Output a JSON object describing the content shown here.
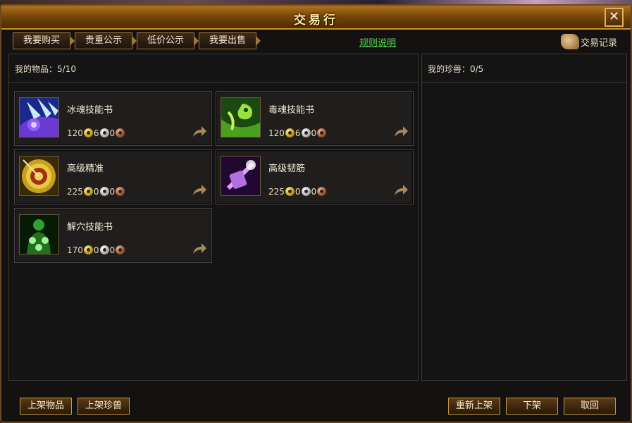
{
  "window": {
    "title": "交易行",
    "close_label": "✕"
  },
  "tabs": [
    {
      "label": "我要购买"
    },
    {
      "label": "贵重公示"
    },
    {
      "label": "低价公示"
    },
    {
      "label": "我要出售"
    }
  ],
  "rules_link": "规则说明",
  "records_label": "交易记录",
  "left_panel": {
    "header": "我的物品：5/10"
  },
  "right_panel": {
    "header": "我的珍兽：0/5"
  },
  "items": [
    {
      "name": "冰魂技能书",
      "gold": "120",
      "silver": "6",
      "copper": "0",
      "icon": "ice-soul-skillbook-icon"
    },
    {
      "name": "毒魂技能书",
      "gold": "120",
      "silver": "6",
      "copper": "0",
      "icon": "poison-soul-skillbook-icon"
    },
    {
      "name": "高级精准",
      "gold": "225",
      "silver": "0",
      "copper": "0",
      "icon": "target-accuracy-icon"
    },
    {
      "name": "高级韧筋",
      "gold": "225",
      "silver": "0",
      "copper": "0",
      "icon": "purple-tendon-icon"
    },
    {
      "name": "解穴技能书",
      "gold": "170",
      "silver": "0",
      "copper": "0",
      "icon": "acupoint-skillbook-icon"
    }
  ],
  "bottom_buttons": {
    "list_item": "上架物品",
    "list_pet": "上架珍兽",
    "relist": "重新上架",
    "delist": "下架",
    "cancel": "取回"
  },
  "colors": {
    "accent_gold": "#c8902a",
    "link_green": "#4ee04e"
  }
}
